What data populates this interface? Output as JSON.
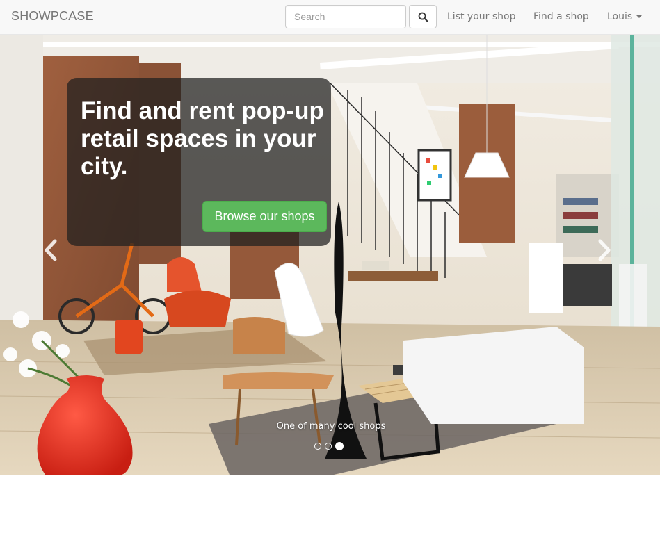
{
  "navbar": {
    "brand": "SHOWPCASE",
    "search": {
      "placeholder": "Search",
      "value": ""
    },
    "search_button_icon": "search-icon",
    "links": [
      {
        "label": "List your shop"
      },
      {
        "label": "Find a shop"
      },
      {
        "label": "Louis",
        "icon": "caret-down-icon"
      }
    ]
  },
  "hero": {
    "title": "Find and rent pop-up retail spaces in your city.",
    "cta_label": "Browse our shops",
    "caption": "One of many cool shops",
    "slides_total": 3,
    "active_slide": 3,
    "controls": {
      "prev_icon": "chevron-left-icon",
      "next_icon": "chevron-right-icon"
    }
  },
  "colors": {
    "navbar_bg": "#f8f8f8",
    "brand_text": "#777777",
    "cta_green": "#5cb85c",
    "panel_overlay": "rgba(30,30,30,0.72)"
  }
}
